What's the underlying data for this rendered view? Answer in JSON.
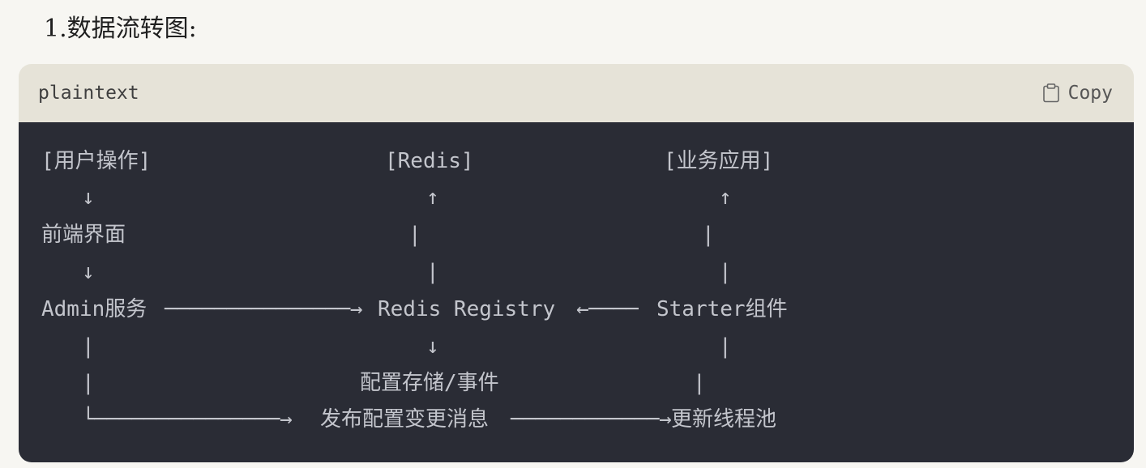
{
  "heading": "1.数据流转图:",
  "code_block": {
    "language": "plaintext",
    "copy_label": "Copy",
    "copy_icon": "clipboard-icon",
    "lines": [
      [
        "[用户操作]",
        "[Redis]",
        "[业务应用]"
      ],
      [
        "↓",
        "↑",
        "↑"
      ],
      [
        "前端界面",
        "|",
        "|"
      ],
      [
        "↓",
        "|",
        "|"
      ],
      [
        "Admin服务",
        "───────────────→",
        "Redis Registry",
        "←────",
        "Starter组件"
      ],
      [
        "|",
        "↓",
        "|"
      ],
      [
        "|",
        "配置存储/事件",
        "|"
      ],
      [
        "└───────────────→",
        "发布配置变更消息",
        "────────────→",
        "更新线程池"
      ]
    ]
  }
}
